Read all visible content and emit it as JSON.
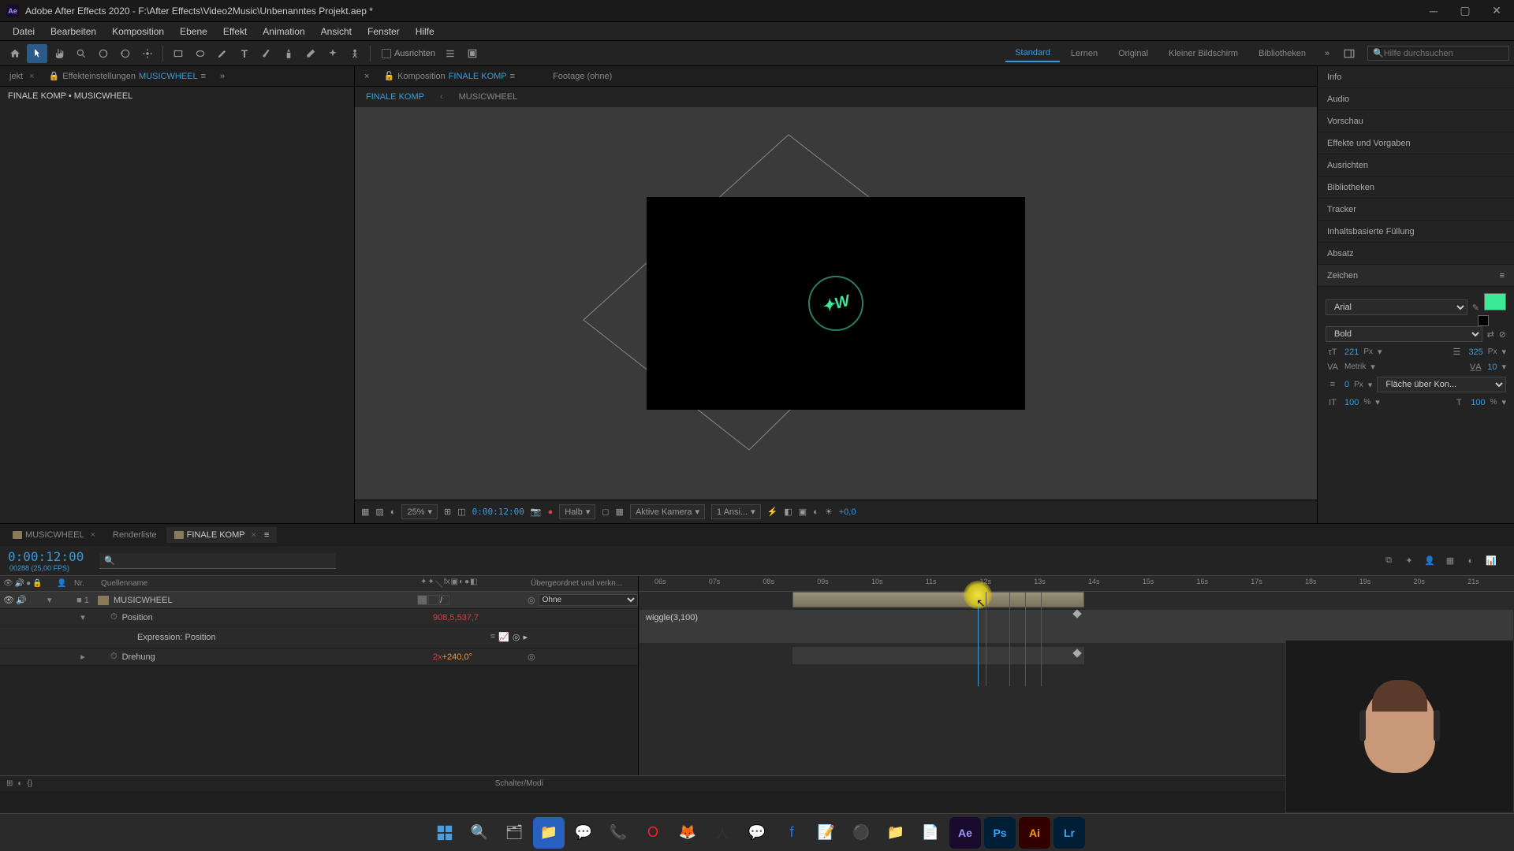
{
  "titlebar": {
    "app": "Ae",
    "title": "Adobe After Effects 2020 - F:\\After Effects\\Video2Music\\Unbenanntes Projekt.aep *"
  },
  "menubar": [
    "Datei",
    "Bearbeiten",
    "Komposition",
    "Ebene",
    "Effekt",
    "Animation",
    "Ansicht",
    "Fenster",
    "Hilfe"
  ],
  "toolbar": {
    "align": "Ausrichten",
    "workspaces": [
      "Standard",
      "Lernen",
      "Original",
      "Kleiner Bildschirm",
      "Bibliotheken"
    ],
    "active_workspace": "Standard",
    "search_placeholder": "Hilfe durchsuchen"
  },
  "left_panel": {
    "tabs": {
      "project": "jekt",
      "effects": "Effekteinstellungen",
      "effects_target": "MUSICWHEEL"
    },
    "breadcrumb": "FINALE KOMP • MUSICWHEEL"
  },
  "center_panel": {
    "tabs": {
      "comp_label": "Komposition",
      "comp_name": "FINALE KOMP",
      "footage": "Footage (ohne)"
    },
    "crumbs": [
      "FINALE KOMP",
      "MUSICWHEEL"
    ],
    "controls": {
      "zoom": "25%",
      "timecode": "0:00:12:00",
      "resolution": "Halb",
      "camera": "Aktive Kamera",
      "views": "1 Ansi...",
      "exposure": "+0,0"
    }
  },
  "right_panels": [
    "Info",
    "Audio",
    "Vorschau",
    "Effekte und Vorgaben",
    "Ausrichten",
    "Bibliotheken",
    "Tracker",
    "Inhaltsbasierte Füllung",
    "Absatz",
    "Zeichen"
  ],
  "character": {
    "font": "Arial",
    "weight": "Bold",
    "size": "221",
    "size_unit": "Px",
    "leading": "325",
    "leading_unit": "Px",
    "kerning": "Metrik",
    "tracking": "10",
    "stroke": "0",
    "stroke_unit": "Px",
    "stroke_mode": "Fläche über Kon...",
    "scale_v": "100",
    "scale_h": "100",
    "percent": "%"
  },
  "timeline": {
    "tabs": [
      "MUSICWHEEL",
      "Renderliste",
      "FINALE KOMP"
    ],
    "active_tab": 2,
    "timecode": "0:00:12:00",
    "fps_hint": "00288 (25,00 FPS)",
    "columns": {
      "nr": "Nr.",
      "name": "Quellenname",
      "parent": "Übergeordnet und verkn..."
    },
    "layer": {
      "num": "1",
      "name": "MUSICWHEEL",
      "parent": "Ohne",
      "props": {
        "position": "Position",
        "position_val": "908,5,537,7",
        "expr_label": "Expression: Position",
        "rotation": "Drehung",
        "rotation_val_a": "2x",
        "rotation_val_b": "+240,0°"
      }
    },
    "expression": "wiggle(3,100)",
    "ruler": [
      "06s",
      "07s",
      "08s",
      "09s",
      "10s",
      "11s",
      "12s",
      "13s",
      "14s",
      "15s",
      "16s",
      "17s",
      "18s",
      "19s",
      "20s",
      "21s"
    ],
    "footer": "Schalter/Modi"
  },
  "taskbar": {
    "icons": [
      "win",
      "search",
      "tasks",
      "explorer",
      "chat",
      "whatsapp",
      "opera",
      "firefox",
      "figure",
      "messenger",
      "facebook",
      "notes",
      "obs",
      "folder",
      "notepad",
      "ae",
      "ps",
      "ai",
      "lr"
    ]
  }
}
